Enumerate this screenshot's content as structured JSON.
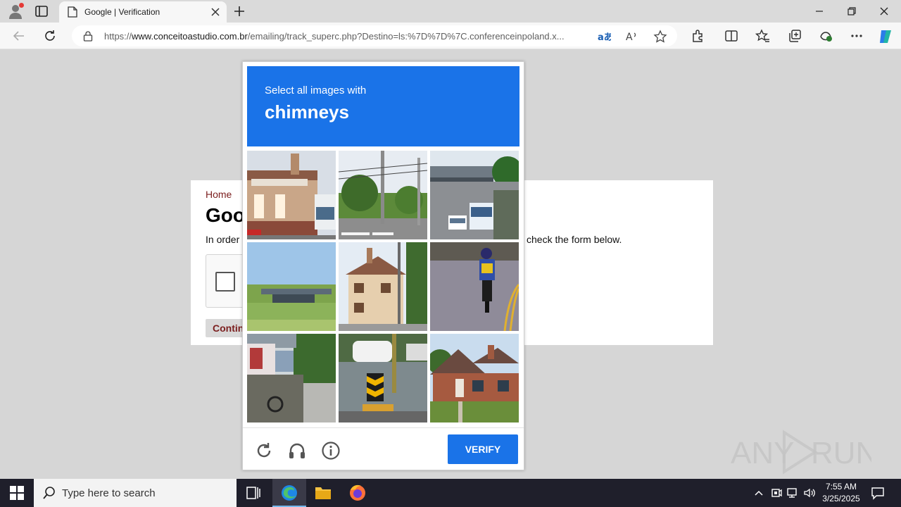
{
  "browser": {
    "tab_title": "Google | Verification",
    "url_prefix": "https://",
    "url_domain": "www.conceitoastudio.com.br",
    "url_rest": "/emailing/track_superc.php?Destino=ls:%7D%7D%7C.conferenceinpoland.x..."
  },
  "page": {
    "breadcrumb": "Home",
    "heading": "Goo",
    "intro_start": "In order",
    "intro_end": "check the form below.",
    "continue_label": "Contin"
  },
  "captcha": {
    "instruction": "Select all images with",
    "target": "chimneys",
    "verify_label": "VERIFY",
    "tiles": [
      "building-with-trucks",
      "street-with-utility-poles",
      "overpass-with-bus",
      "bridge-over-grass",
      "house-with-chimney",
      "motorcyclist-on-road",
      "street-stalls",
      "road-hazard-sign",
      "brick-house-with-chimney"
    ]
  },
  "watermark": "ANY RUN",
  "taskbar": {
    "search_placeholder": "Type here to search",
    "time": "7:55 AM",
    "date": "3/25/2025"
  },
  "colors": {
    "captcha_blue": "#1a73e8",
    "link_red": "#7b1e1e",
    "taskbar": "#1f1f2b"
  }
}
